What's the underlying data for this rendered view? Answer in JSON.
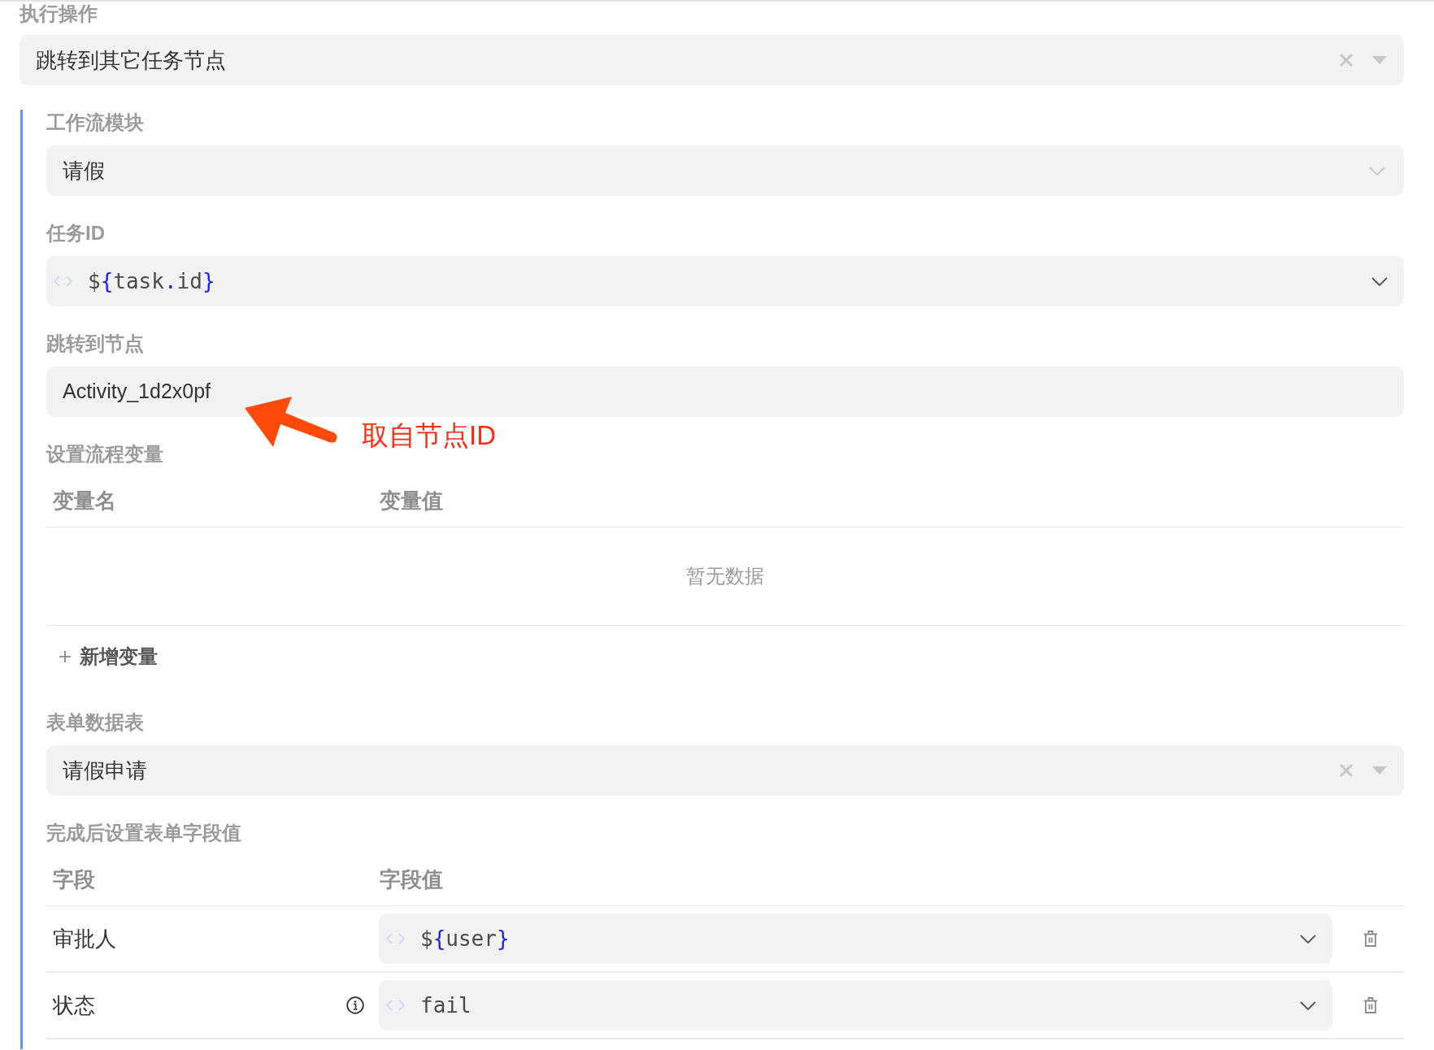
{
  "action": {
    "label": "执行操作",
    "field": {
      "kind": "select",
      "value": "跳转到其它任务节点",
      "clearable": true
    }
  },
  "config": {
    "sections": [
      {
        "kind": "field",
        "label": "工作流模块",
        "field": {
          "kind": "select",
          "value": "请假",
          "clearable": false
        }
      },
      {
        "kind": "field",
        "label": "任务ID",
        "field": {
          "kind": "code",
          "value": "${task.id}"
        }
      },
      {
        "kind": "field",
        "label": "跳转到节点",
        "field": {
          "kind": "input",
          "value": "Activity_1d2x0pf"
        },
        "annotation": "取自节点ID"
      },
      {
        "kind": "table",
        "label": "设置流程变量",
        "columns": [
          "变量名",
          "变量值"
        ],
        "empty_text": "暂无数据",
        "add_button": "新增变量"
      },
      {
        "kind": "field",
        "label": "表单数据表",
        "field": {
          "kind": "select",
          "value": "请假申请",
          "clearable": true
        }
      },
      {
        "kind": "table",
        "label": "完成后设置表单字段值",
        "columns": [
          "字段",
          "字段值"
        ],
        "rows": [
          {
            "field": "审批人",
            "info": false,
            "value": {
              "kind": "code",
              "value": "${user}"
            }
          },
          {
            "field": "状态",
            "info": true,
            "value": {
              "kind": "code",
              "value": "fail"
            }
          }
        ]
      }
    ]
  }
}
